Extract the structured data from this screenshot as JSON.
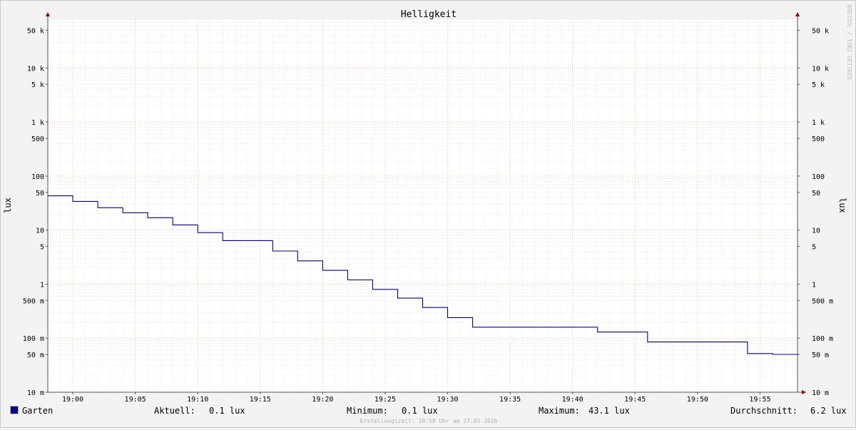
{
  "chart_data": {
    "type": "line",
    "title": "Helligkeit",
    "ylabel_left": "lux",
    "ylabel_right": "lux",
    "watermark": "RRDTOOL / TOBI OETIKER",
    "y_scale": "log",
    "ylim": [
      0.01,
      80000
    ],
    "y_ticks": [
      {
        "value": 50000,
        "label": "50 k"
      },
      {
        "value": 10000,
        "label": "10 k"
      },
      {
        "value": 5000,
        "label": "5 k"
      },
      {
        "value": 1000,
        "label": "1 k"
      },
      {
        "value": 500,
        "label": "500"
      },
      {
        "value": 100,
        "label": "100"
      },
      {
        "value": 50,
        "label": "50"
      },
      {
        "value": 10,
        "label": "10"
      },
      {
        "value": 5,
        "label": "5"
      },
      {
        "value": 1,
        "label": "1"
      },
      {
        "value": 0.5,
        "label": "500 m"
      },
      {
        "value": 0.1,
        "label": "100 m"
      },
      {
        "value": 0.05,
        "label": "50 m"
      },
      {
        "value": 0.01,
        "label": "10 m"
      }
    ],
    "x_range": [
      "18:58",
      "19:58"
    ],
    "x_ticks": [
      "19:00",
      "19:05",
      "19:10",
      "19:15",
      "19:20",
      "19:25",
      "19:30",
      "19:35",
      "19:40",
      "19:45",
      "19:50",
      "19:55"
    ],
    "grid": true,
    "series": [
      {
        "name": "Garten",
        "color": "#000099",
        "step": true,
        "points": [
          [
            "18:58",
            43.1
          ],
          [
            "19:00",
            34
          ],
          [
            "19:02",
            26
          ],
          [
            "19:04",
            21
          ],
          [
            "19:06",
            17
          ],
          [
            "19:08",
            12.5
          ],
          [
            "19:10",
            9
          ],
          [
            "19:12",
            6.4
          ],
          [
            "19:16",
            4.1
          ],
          [
            "19:18",
            2.7
          ],
          [
            "19:20",
            1.8
          ],
          [
            "19:22",
            1.2
          ],
          [
            "19:24",
            0.8
          ],
          [
            "19:26",
            0.55
          ],
          [
            "19:28",
            0.37
          ],
          [
            "19:30",
            0.24
          ],
          [
            "19:32",
            0.16
          ],
          [
            "19:42",
            0.13
          ],
          [
            "19:46",
            0.085
          ],
          [
            "19:54",
            0.052
          ],
          [
            "19:56",
            0.05
          ],
          [
            "19:58",
            0.05
          ]
        ]
      }
    ]
  },
  "legend": {
    "series_name": "Garten",
    "series_color": "#000099",
    "current_label": "Aktuell:",
    "current_value": "0.1 lux",
    "min_label": "Minimum:",
    "min_value": "0.1 lux",
    "max_label": "Maximum:",
    "max_value": "43.1 lux",
    "avg_label": "Durchschnitt:",
    "avg_value": "6.2 lux"
  },
  "footer": {
    "created": "Erstellungszeit: 19:58 Uhr am 27.03.2026"
  }
}
